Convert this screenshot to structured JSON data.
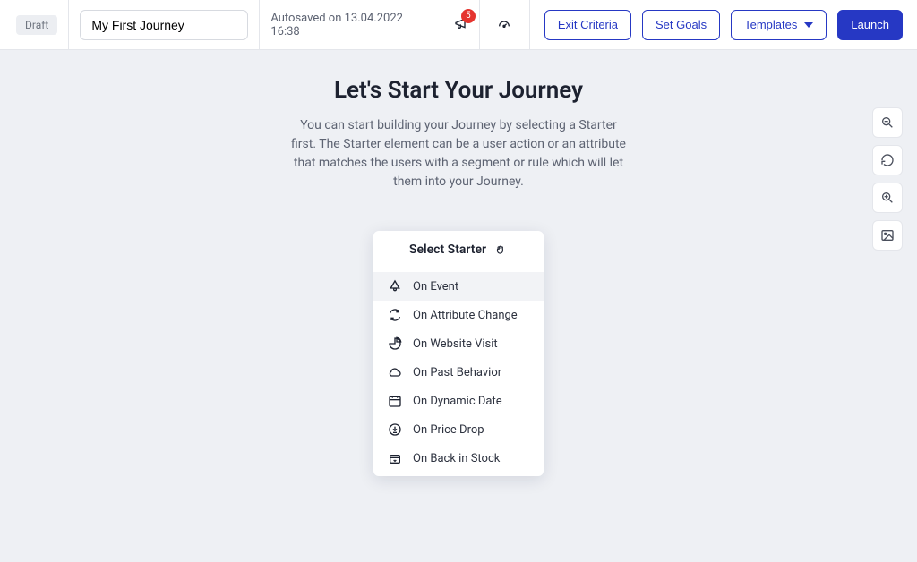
{
  "topbar": {
    "draft_label": "Draft",
    "title_value": "My First Journey",
    "autosaved_text": "Autosaved on 13.04.2022 16:38",
    "bell_badge": "5",
    "exit_criteria": "Exit Criteria",
    "set_goals": "Set Goals",
    "templates": "Templates",
    "launch": "Launch"
  },
  "hero": {
    "title": "Let's Start Your Journey",
    "desc": "You can start building your Journey by selecting a Starter first. The Starter element can be a user action or an attribute that matches the users with a segment or rule which will let them into your Journey."
  },
  "starter": {
    "header": "Select Starter",
    "items": [
      {
        "label": "On Event",
        "icon": "event",
        "highlighted": true
      },
      {
        "label": "On Attribute Change",
        "icon": "refresh",
        "highlighted": false
      },
      {
        "label": "On Website Visit",
        "icon": "pie",
        "highlighted": false
      },
      {
        "label": "On Past Behavior",
        "icon": "cloud",
        "highlighted": false
      },
      {
        "label": "On Dynamic Date",
        "icon": "calendar",
        "highlighted": false
      },
      {
        "label": "On Price Drop",
        "icon": "pricedrop",
        "highlighted": false
      },
      {
        "label": "On Back in Stock",
        "icon": "box",
        "highlighted": false
      }
    ]
  },
  "tools": {
    "zoom_out": "zoom-out",
    "reset": "refresh",
    "zoom_in": "zoom-in",
    "image": "image"
  }
}
